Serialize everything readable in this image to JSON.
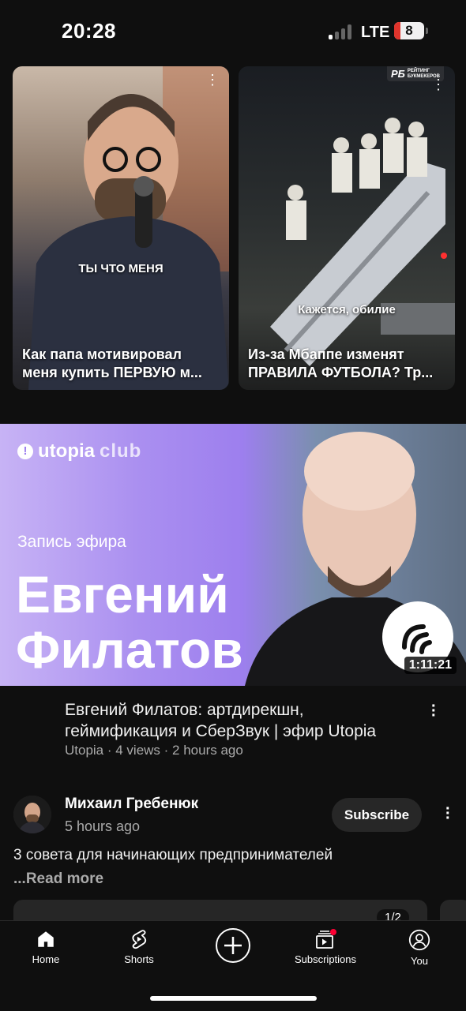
{
  "status_bar": {
    "time": "20:28",
    "network": "LTE",
    "battery": "8"
  },
  "shorts": [
    {
      "title": "Как папа мотивировал меня купить ПЕРВУЮ м...",
      "caption": "ТЫ ЧТО МЕНЯ"
    },
    {
      "title": "Из-за Мбаппе изменят ПРАВИЛА ФУТБОЛА? Тр...",
      "caption": "Кажется, обилие",
      "badge_main": "РБ",
      "badge_sub1": "РЕЙТИНГ",
      "badge_sub2": "БУКМЕКЕРОВ"
    }
  ],
  "video": {
    "brand": "utopia",
    "brand_suffix": "club",
    "thumb_subtitle": "Запись эфира",
    "thumb_title_line1": "Евгений",
    "thumb_title_line2": "Филатов",
    "duration": "1:11:21",
    "title": "Евгений Филатов: артдирекшн, геймификация и СберЗвук | эфир Utopia",
    "meta": "Utopia · 4 views · 2 hours ago"
  },
  "post": {
    "author": "Михаил Гребенюк",
    "time": "5 hours ago",
    "subscribe_label": "Subscribe",
    "text": "3 совета для начинающих предпринимателей",
    "read_more": "...Read more",
    "counter": "1/2"
  },
  "nav": {
    "home": "Home",
    "shorts": "Shorts",
    "subscriptions": "Subscriptions",
    "you": "You"
  },
  "colors": {
    "background": "#0f0f0f",
    "accent_red": "#ff0033",
    "thumb_purple": "#9d7fee"
  }
}
